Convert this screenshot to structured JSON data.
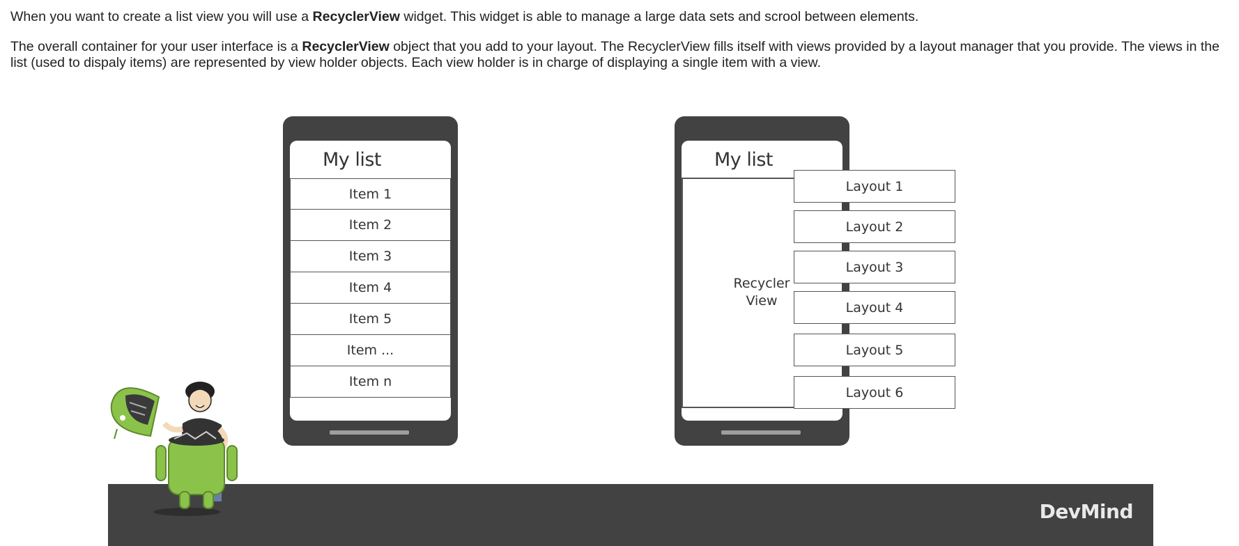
{
  "paragraph1": {
    "before": "When you want to create a list view you will use a ",
    "bold": "RecyclerView",
    "after": " widget. This widget is able to manage a large data sets and scrool between elements."
  },
  "paragraph2": {
    "before": "The overall container for your user interface is a ",
    "bold": "RecyclerView",
    "after": " object that you add to your layout. The RecyclerView fills itself with views provided by a layout manager that you provide. The views in the list (used to dispaly items) are represented by view holder objects. Each view holder is in charge of displaying a single item with a view."
  },
  "left_phone": {
    "title": "My list",
    "items": [
      "Item 1",
      "Item 2",
      "Item 3",
      "Item 4",
      "Item 5",
      "Item ...",
      "Item n"
    ]
  },
  "right_phone": {
    "title": "My list",
    "recycler_label_line1": "Recycler",
    "recycler_label_line2": "View",
    "layouts": [
      "Layout 1",
      "Layout 2",
      "Layout 3",
      "Layout 4",
      "Layout 5",
      "Layout 6"
    ]
  },
  "brand": "DevMind",
  "colors": {
    "phone_body": "#424242",
    "ground": "#424242",
    "android_green": "#8bc34a"
  },
  "icons": {
    "mascot": "android-with-person-illustration"
  }
}
